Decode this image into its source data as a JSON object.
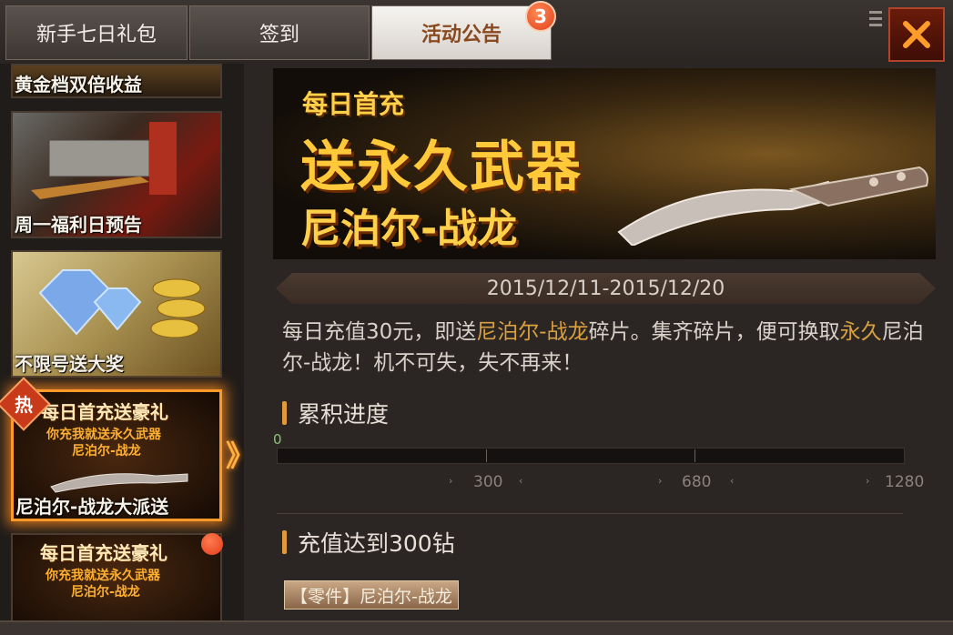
{
  "tabs": [
    {
      "label": "新手七日礼包"
    },
    {
      "label": "签到"
    },
    {
      "label": "活动公告",
      "badge": "3"
    }
  ],
  "sidebar": {
    "items": [
      {
        "label": "黄金档双倍收益"
      },
      {
        "label": "周一福利日预告"
      },
      {
        "label": "不限号送大奖"
      },
      {
        "title": "每日首充送豪礼",
        "line1": "你充我就送永久武器",
        "line2": "尼泊尔-战龙",
        "label": "尼泊尔-战龙大派送",
        "tag": "热",
        "selected": true
      },
      {
        "title": "每日首充送豪礼",
        "line1": "你充我就送永久武器",
        "line2": "尼泊尔-战龙"
      }
    ],
    "arrow": "》"
  },
  "banner": {
    "subtitle": "每日首充",
    "title": "送永久武器",
    "weapon": "尼泊尔-战龙"
  },
  "event": {
    "date_range": "2015/12/11-2015/12/20",
    "desc_part1": "每日充值30元，即送",
    "desc_hl1": "尼泊尔-战龙",
    "desc_part2": "碎片。集齐碎片，便可换取",
    "desc_hl2": "永久",
    "desc_part3": "尼泊尔-战龙！机不可失，失不再来！"
  },
  "progress": {
    "heading": "累积进度",
    "current": "0",
    "current_value": 0,
    "max_value": 1280,
    "milestones": [
      "300",
      "680",
      "1280"
    ]
  },
  "reward": {
    "heading": "充值达到300钻",
    "item_label": "【零件】尼泊尔-战龙"
  },
  "colors": {
    "accent_orange": "#e09a3a",
    "highlight_gold": "#d9a040",
    "badge_red": "#e2401b",
    "close_red": "#b0442a"
  },
  "icons": {
    "close": "close-icon",
    "menu": "menu-icon"
  }
}
